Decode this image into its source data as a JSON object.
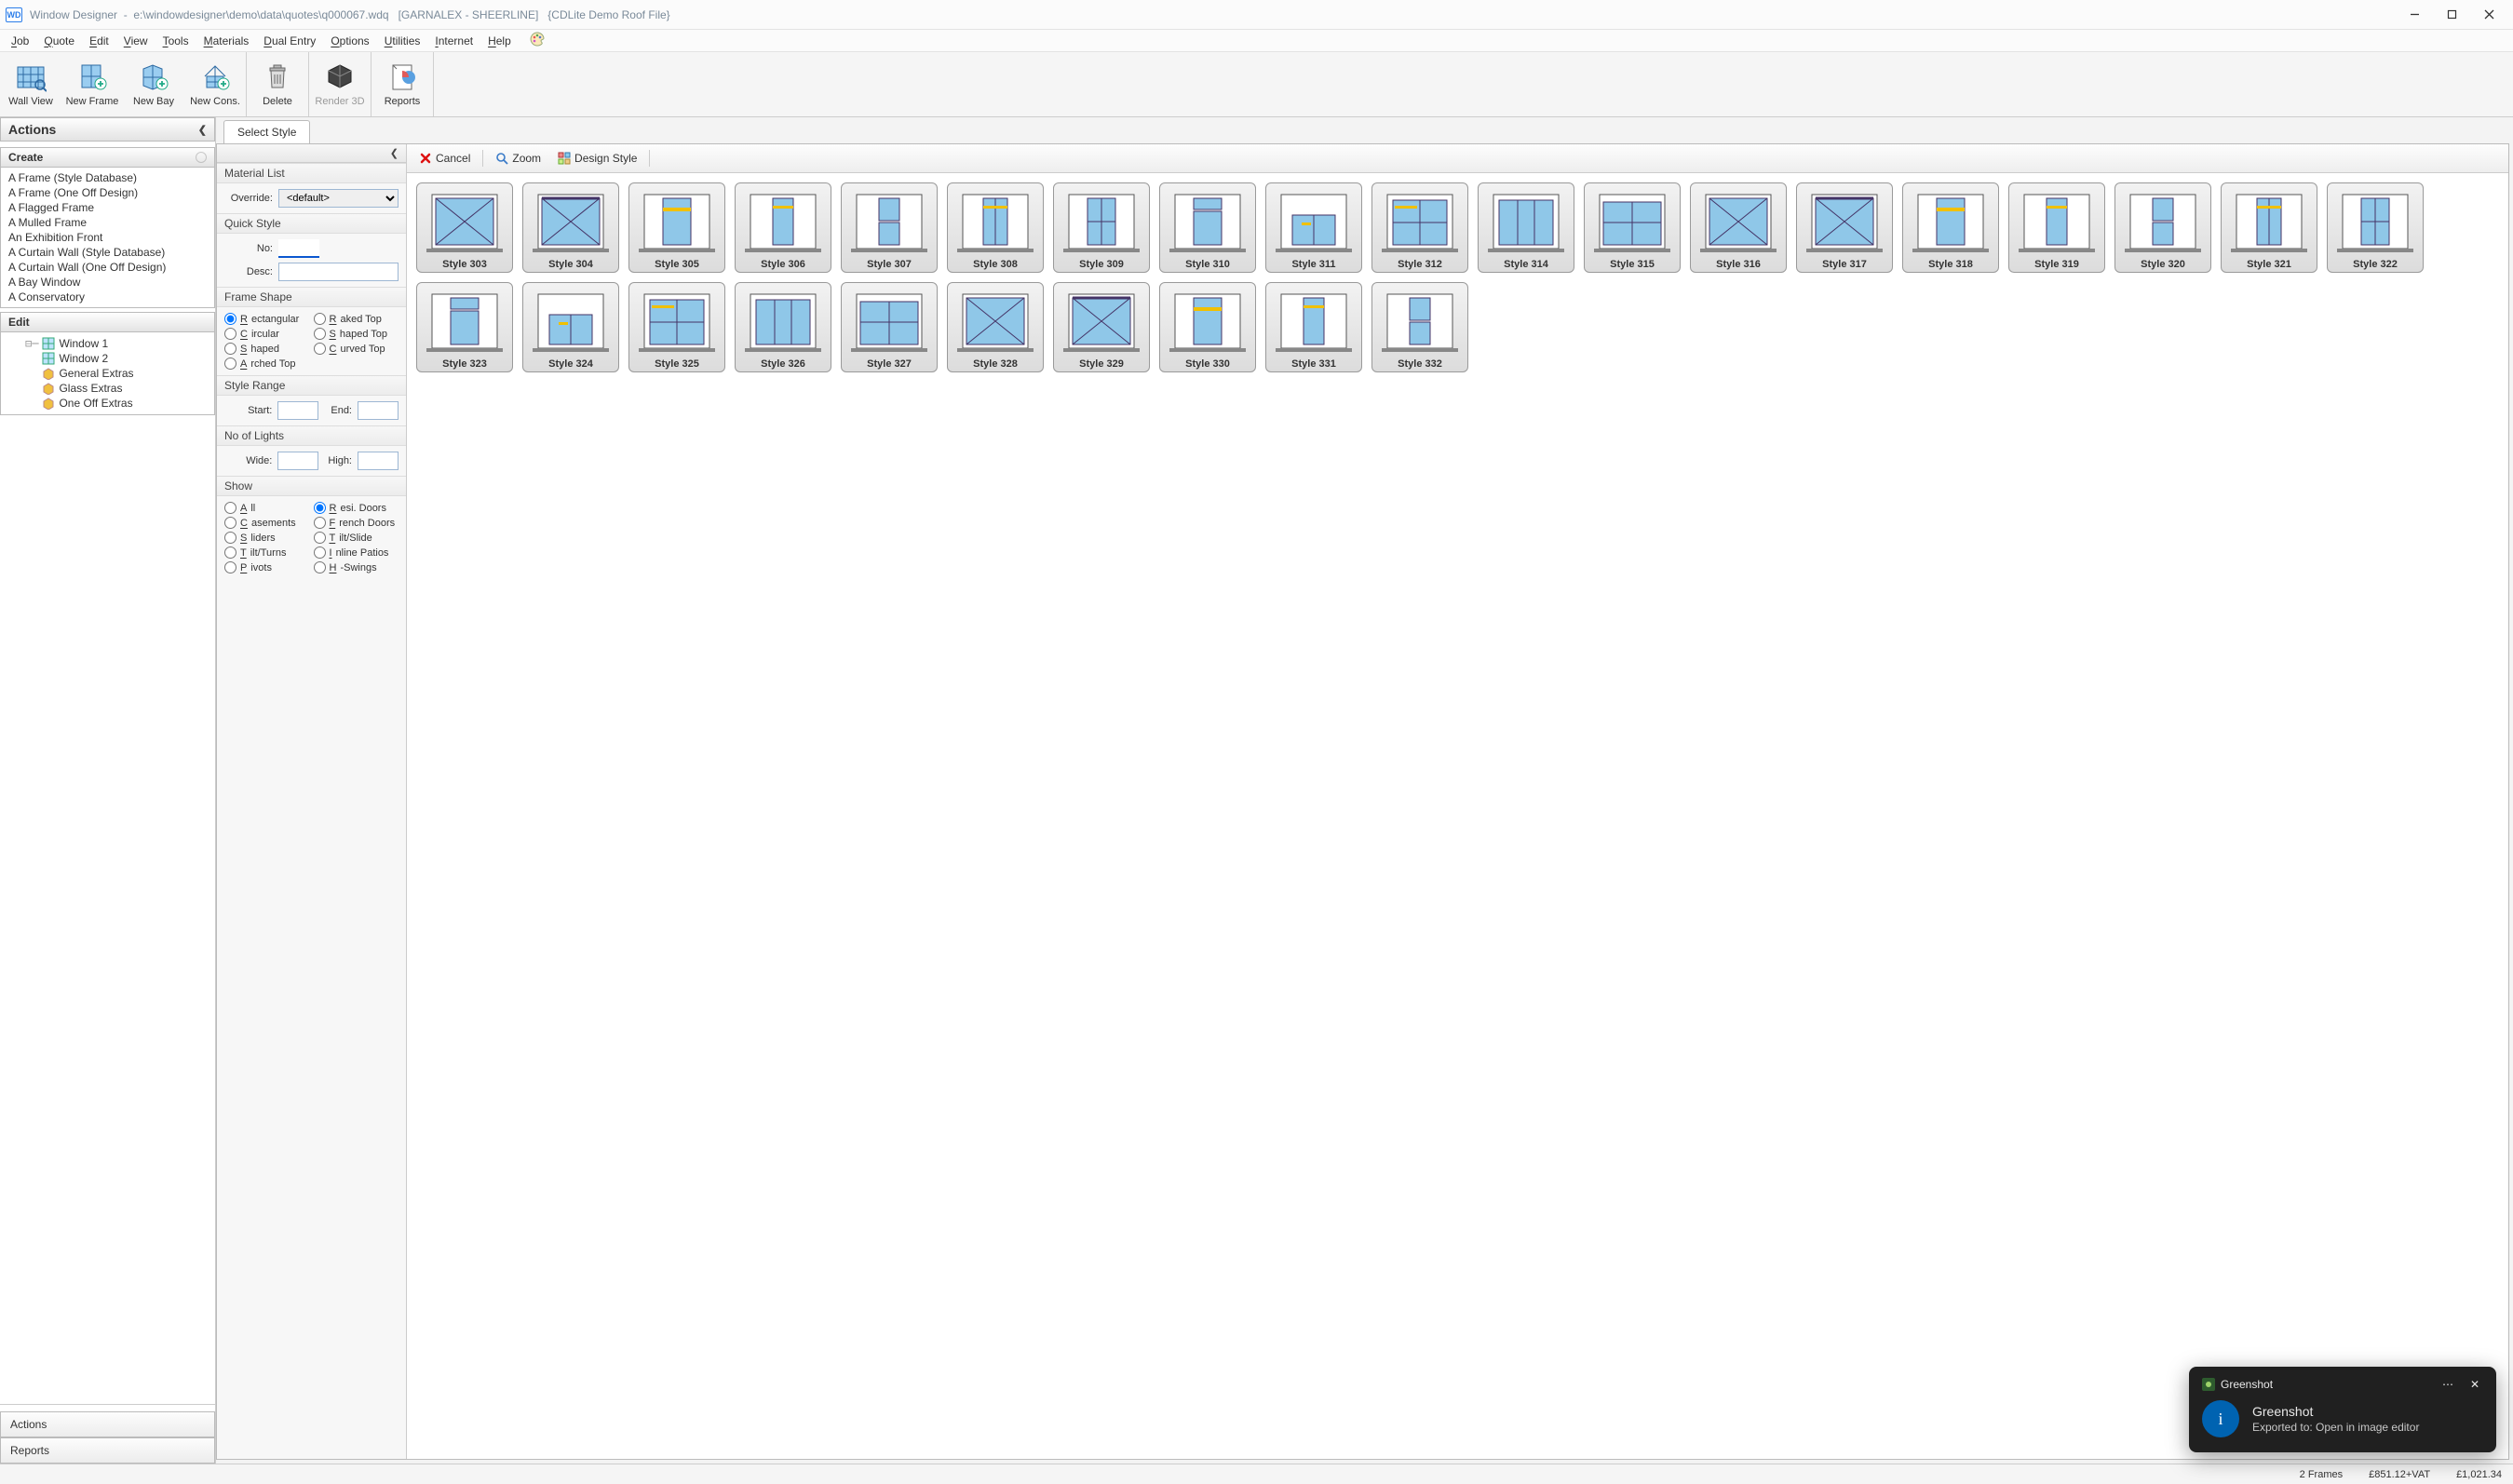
{
  "title": "Window Designer  -  e:\\windowdesigner\\demo\\data\\quotes\\q000067.wdq   [GARNALEX - SHEERLINE]   {CDLite Demo Roof File}",
  "menu": {
    "items": [
      "Job",
      "Quote",
      "Edit",
      "View",
      "Tools",
      "Materials",
      "Dual Entry",
      "Options",
      "Utilities",
      "Internet",
      "Help"
    ]
  },
  "toolbar": {
    "groups": [
      {
        "items": [
          {
            "label": "Wall View",
            "name": "wall-view-button"
          },
          {
            "label": "New Frame",
            "name": "new-frame-button"
          },
          {
            "label": "New Bay",
            "name": "new-bay-button"
          },
          {
            "label": "New Cons.",
            "name": "new-cons-button"
          }
        ]
      },
      {
        "items": [
          {
            "label": "Delete",
            "name": "delete-button"
          }
        ]
      },
      {
        "items": [
          {
            "label": "Render 3D",
            "name": "render-3d-button",
            "disabled": true
          }
        ]
      },
      {
        "items": [
          {
            "label": "Reports",
            "name": "reports-button"
          }
        ]
      }
    ]
  },
  "actions_panel": {
    "title": "Actions",
    "create": {
      "title": "Create",
      "items": [
        "A Frame (Style Database)",
        "A Frame (One Off Design)",
        "A Flagged Frame",
        "A Mulled Frame",
        "An Exhibition Front",
        "A Curtain Wall (Style Database)",
        "A Curtain Wall (One Off Design)",
        "A Bay Window",
        "A Conservatory"
      ]
    },
    "edit": {
      "title": "Edit",
      "items": [
        "Window 1",
        "Window 2",
        "General Extras",
        "Glass Extras",
        "One Off Extras"
      ]
    },
    "bottom": {
      "actions": "Actions",
      "reports": "Reports"
    }
  },
  "tab": {
    "label": "Select Style"
  },
  "style_panel": {
    "sections": {
      "material_list": "Material List",
      "override": "Override:",
      "override_value": "<default>",
      "quick_style": "Quick Style",
      "no": "No:",
      "no_value": "",
      "desc": "Desc:",
      "desc_value": "",
      "frame_shape": "Frame Shape",
      "shapes": [
        "Rectangular",
        "Raked Top",
        "Circular",
        "Shaped Top",
        "Shaped",
        "Curved Top",
        "Arched Top"
      ],
      "shape_selected": "Rectangular",
      "style_range": "Style Range",
      "start": "Start:",
      "start_value": "",
      "end": "End:",
      "end_value": "",
      "no_of_lights": "No of Lights",
      "wide": "Wide:",
      "wide_value": "",
      "high": "High:",
      "high_value": "",
      "show": "Show",
      "show_opts": [
        "All",
        "Resi. Doors",
        "Casements",
        "French Doors",
        "Sliders",
        "Tilt/Slide",
        "Tilt/Turns",
        "Inline Patios",
        "Pivots",
        "H-Swings"
      ],
      "show_selected": "Resi. Doors"
    }
  },
  "gallery_toolbar": {
    "cancel": "Cancel",
    "zoom": "Zoom",
    "design": "Design Style"
  },
  "styles": [
    {
      "label": "Style 303"
    },
    {
      "label": "Style 304"
    },
    {
      "label": "Style 305"
    },
    {
      "label": "Style 306"
    },
    {
      "label": "Style 307"
    },
    {
      "label": "Style 308"
    },
    {
      "label": "Style 309"
    },
    {
      "label": "Style 310"
    },
    {
      "label": "Style 311"
    },
    {
      "label": "Style 312"
    },
    {
      "label": "Style 314"
    },
    {
      "label": "Style 315"
    },
    {
      "label": "Style 316"
    },
    {
      "label": "Style 317"
    },
    {
      "label": "Style 318"
    },
    {
      "label": "Style 319"
    },
    {
      "label": "Style 320"
    },
    {
      "label": "Style 321"
    },
    {
      "label": "Style 322"
    },
    {
      "label": "Style 323"
    },
    {
      "label": "Style 324"
    },
    {
      "label": "Style 325"
    },
    {
      "label": "Style 326"
    },
    {
      "label": "Style 327"
    },
    {
      "label": "Style 328"
    },
    {
      "label": "Style 329"
    },
    {
      "label": "Style 330"
    },
    {
      "label": "Style 331"
    },
    {
      "label": "Style 332"
    }
  ],
  "status": {
    "frames": "2 Frames",
    "subtotal": "£851.12+VAT",
    "total": "£1,021.34"
  },
  "toast": {
    "app": "Greenshot",
    "title": "Greenshot",
    "msg": "Exported to: Open in image editor"
  }
}
